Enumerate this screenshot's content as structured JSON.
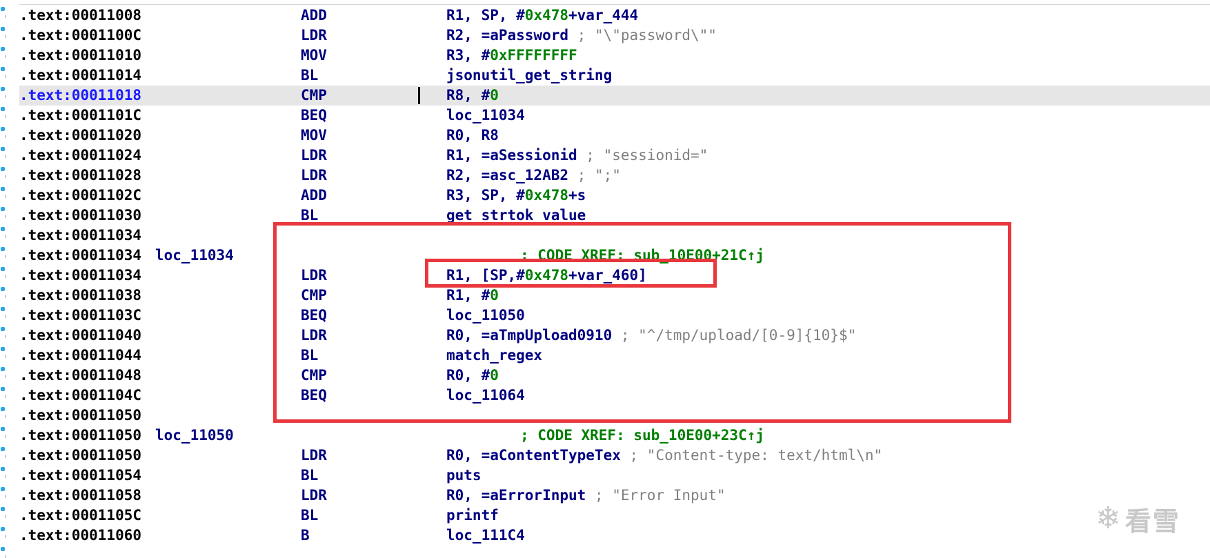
{
  "listing": [
    {
      "addr": ".text:00011008",
      "label": "",
      "mnem": "ADD",
      "ops": [
        {
          "t": "R1, SP, #"
        },
        {
          "t": "0x478",
          "c": "num"
        },
        {
          "t": "+var_444"
        }
      ],
      "xref": ""
    },
    {
      "addr": ".text:0001100C",
      "label": "",
      "mnem": "LDR",
      "ops": [
        {
          "t": "R2, =aPassword "
        },
        {
          "t": "; \"\\\"password\\\"\"",
          "c": "cmt"
        }
      ],
      "xref": ""
    },
    {
      "addr": ".text:00011010",
      "label": "",
      "mnem": "MOV",
      "ops": [
        {
          "t": "R3, #"
        },
        {
          "t": "0xFFFFFFFF",
          "c": "num"
        }
      ],
      "xref": ""
    },
    {
      "addr": ".text:00011014",
      "label": "",
      "mnem": "BL",
      "ops": [
        {
          "t": "jsonutil_get_string"
        }
      ],
      "xref": ""
    },
    {
      "addr": ".text:00011018",
      "label": "",
      "mnem": "CMP",
      "ops": [
        {
          "t": "R8, #"
        },
        {
          "t": "0",
          "c": "num"
        }
      ],
      "xref": "",
      "highlight": true
    },
    {
      "addr": ".text:0001101C",
      "label": "",
      "mnem": "BEQ",
      "ops": [
        {
          "t": "loc_11034"
        }
      ],
      "xref": ""
    },
    {
      "addr": ".text:00011020",
      "label": "",
      "mnem": "MOV",
      "ops": [
        {
          "t": "R0, R8"
        }
      ],
      "xref": ""
    },
    {
      "addr": ".text:00011024",
      "label": "",
      "mnem": "LDR",
      "ops": [
        {
          "t": "R1, =aSessionid "
        },
        {
          "t": "; \"sessionid=\"",
          "c": "cmt"
        }
      ],
      "xref": ""
    },
    {
      "addr": ".text:00011028",
      "label": "",
      "mnem": "LDR",
      "ops": [
        {
          "t": "R2, =asc_12AB2 "
        },
        {
          "t": "; \";\"",
          "c": "cmt"
        }
      ],
      "xref": ""
    },
    {
      "addr": ".text:0001102C",
      "label": "",
      "mnem": "ADD",
      "ops": [
        {
          "t": "R3, SP, #"
        },
        {
          "t": "0x478",
          "c": "num"
        },
        {
          "t": "+s"
        }
      ],
      "xref": ""
    },
    {
      "addr": ".text:00011030",
      "label": "",
      "mnem": "BL",
      "ops": [
        {
          "t": "get_strtok_value"
        }
      ],
      "xref": ""
    },
    {
      "addr": ".text:00011034",
      "label": "",
      "mnem": "",
      "ops": [],
      "xref": ""
    },
    {
      "addr": ".text:00011034",
      "label": "loc_11034",
      "mnem": "",
      "ops": [],
      "xref": "; CODE XREF: sub_10E00+21C↑j"
    },
    {
      "addr": ".text:00011034",
      "label": "",
      "mnem": "LDR",
      "ops": [
        {
          "t": "R1, [SP,#"
        },
        {
          "t": "0x478",
          "c": "num"
        },
        {
          "t": "+var_460]"
        }
      ],
      "xref": ""
    },
    {
      "addr": ".text:00011038",
      "label": "",
      "mnem": "CMP",
      "ops": [
        {
          "t": "R1, #"
        },
        {
          "t": "0",
          "c": "num"
        }
      ],
      "xref": ""
    },
    {
      "addr": ".text:0001103C",
      "label": "",
      "mnem": "BEQ",
      "ops": [
        {
          "t": "loc_11050"
        }
      ],
      "xref": ""
    },
    {
      "addr": ".text:00011040",
      "label": "",
      "mnem": "LDR",
      "ops": [
        {
          "t": "R0, =aTmpUpload0910 "
        },
        {
          "t": "; \"^/tmp/upload/[0-9]{10}$\"",
          "c": "cmt"
        }
      ],
      "xref": ""
    },
    {
      "addr": ".text:00011044",
      "label": "",
      "mnem": "BL",
      "ops": [
        {
          "t": "match_regex"
        }
      ],
      "xref": ""
    },
    {
      "addr": ".text:00011048",
      "label": "",
      "mnem": "CMP",
      "ops": [
        {
          "t": "R0, #"
        },
        {
          "t": "0",
          "c": "num"
        }
      ],
      "xref": ""
    },
    {
      "addr": ".text:0001104C",
      "label": "",
      "mnem": "BEQ",
      "ops": [
        {
          "t": "loc_11064"
        }
      ],
      "xref": ""
    },
    {
      "addr": ".text:00011050",
      "label": "",
      "mnem": "",
      "ops": [],
      "xref": ""
    },
    {
      "addr": ".text:00011050",
      "label": "loc_11050",
      "mnem": "",
      "ops": [],
      "xref": "; CODE XREF: sub_10E00+23C↑j"
    },
    {
      "addr": ".text:00011050",
      "label": "",
      "mnem": "LDR",
      "ops": [
        {
          "t": "R0, =aContentTypeTex "
        },
        {
          "t": "; \"Content-type: text/html\\n\"",
          "c": "cmt"
        }
      ],
      "xref": ""
    },
    {
      "addr": ".text:00011054",
      "label": "",
      "mnem": "BL",
      "ops": [
        {
          "t": "puts"
        }
      ],
      "xref": ""
    },
    {
      "addr": ".text:00011058",
      "label": "",
      "mnem": "LDR",
      "ops": [
        {
          "t": "R0, =aErrorInput "
        },
        {
          "t": "; \"Error Input\"",
          "c": "cmt"
        }
      ],
      "xref": ""
    },
    {
      "addr": ".text:0001105C",
      "label": "",
      "mnem": "BL",
      "ops": [
        {
          "t": "printf"
        }
      ],
      "xref": ""
    },
    {
      "addr": ".text:00011060",
      "label": "",
      "mnem": "B",
      "ops": [
        {
          "t": "loc_111C4"
        }
      ],
      "xref": ""
    }
  ],
  "watermark": {
    "icon": "snowflake-icon",
    "text": "看雪"
  },
  "colors": {
    "background": "#ffffff",
    "mnemonic": "#000080",
    "number": "#008000",
    "comment": "#808080",
    "highlight_row": "#e6e6e6",
    "annotation": "#e8383d"
  }
}
